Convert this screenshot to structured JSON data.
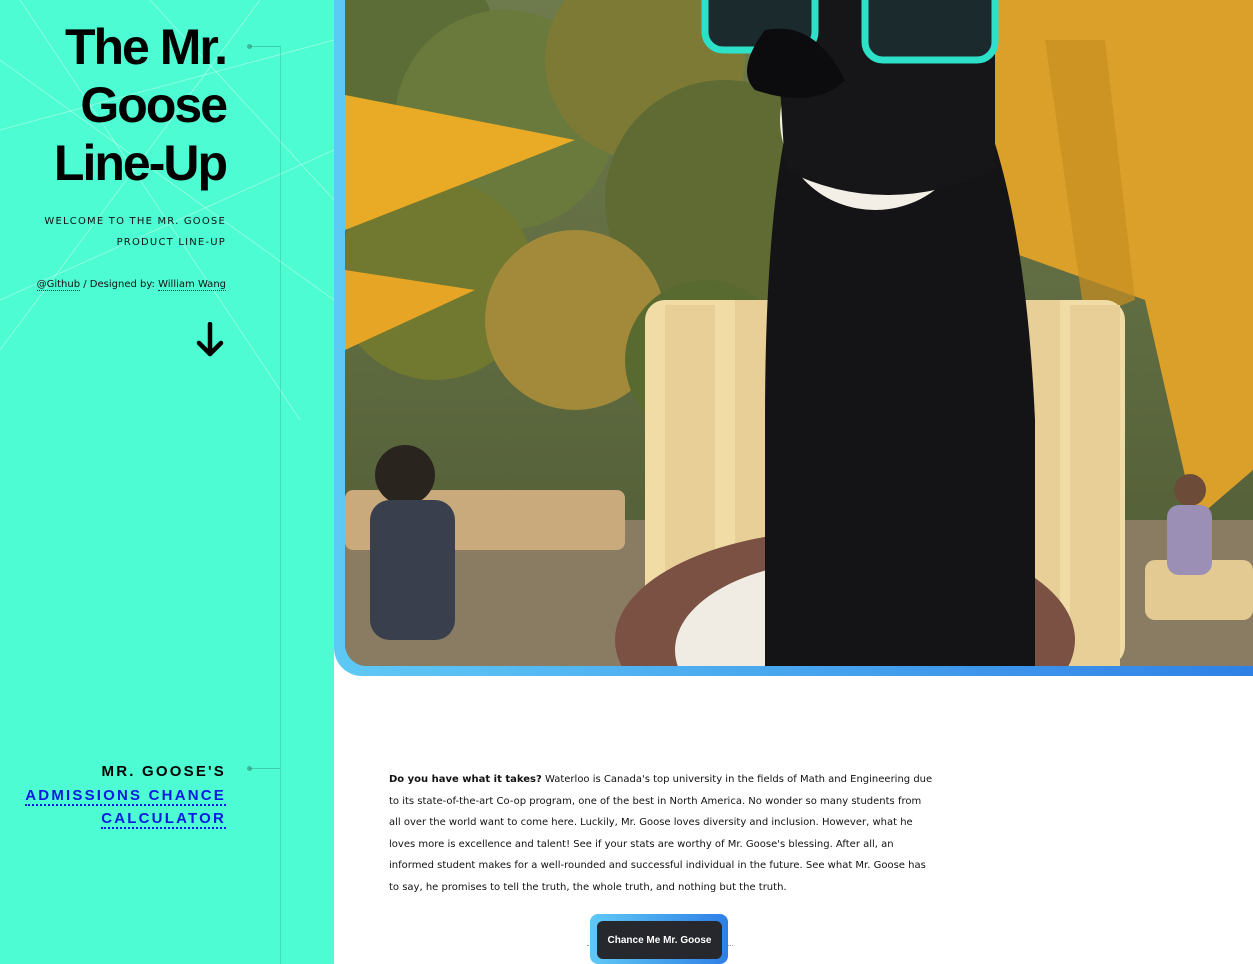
{
  "header": {
    "title": "The Mr. Goose Line-Up",
    "subtitle": "WELCOME TO THE MR. GOOSE PRODUCT LINE-UP",
    "github_label": "@Github",
    "separator": " / Designed by: ",
    "designer_label": "William Wang"
  },
  "section": {
    "prefix": "MR. GOOSE'S",
    "link_label": "ADMISSIONS CHANCE CALCULATOR"
  },
  "content": {
    "lead": "Do you have what it takes?",
    "body": " Waterloo is Canada's top university in the fields of Math and Engineering due to its state-of-the-art Co-op program, one of the best in North America. No wonder so many students from all over the world want to come here. Luckily, Mr. Goose loves diversity and inclusion. However, what he loves more is excellence and talent! See if your stats are worthy of Mr. Goose's blessing. After all, an informed student makes for a well-rounded and successful individual in the future. See what Mr. Goose has to say, he promises to tell the truth, the whole truth, and nothing but the truth."
  },
  "cta": {
    "label": "Chance Me Mr. Goose"
  },
  "icons": {
    "scroll": "arrow-down-icon"
  },
  "colors": {
    "sidebar": "#4dfcd2",
    "link": "#0a1ae0",
    "accent_start": "#5fc9f5",
    "accent_end": "#2f7fe6",
    "button": "#27282d"
  }
}
